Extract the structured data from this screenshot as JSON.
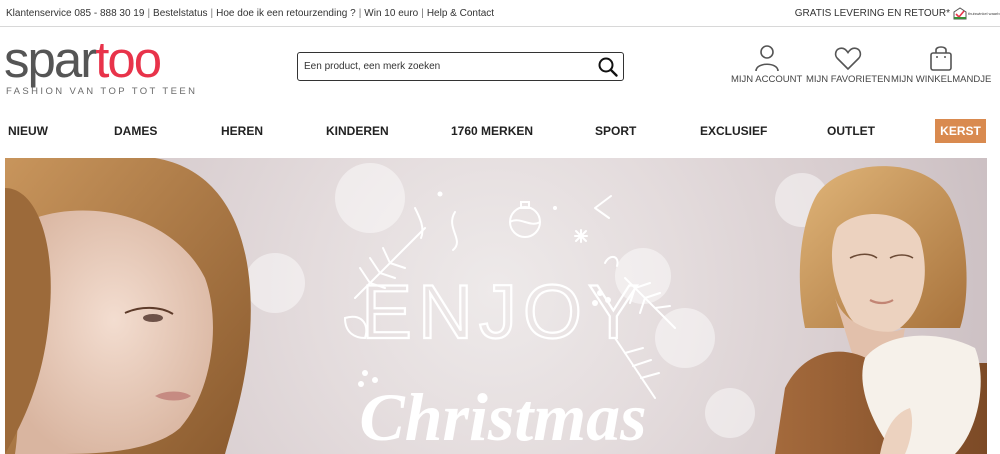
{
  "topbar": {
    "links": [
      "Klantenservice 085 - 888 30 19",
      "Bestelstatus",
      "Hoe doe ik een retourzending ?",
      "Win 10 euro",
      "Help & Contact"
    ],
    "separator": "|",
    "shipping": "GRATIS LEVERING EN RETOUR*",
    "badge_text": "thuiswinkel waarborg"
  },
  "header": {
    "logo_part1": "spar",
    "logo_part2": "too",
    "tagline": "FASHION VAN TOP TOT TEEN",
    "search_placeholder": "Een product, een merk zoeken",
    "account_label": "MIJN ACCOUNT",
    "favorites_label": "MIJN FAVORIETEN",
    "cart_label": "MIJN WINKELMANDJE"
  },
  "nav": {
    "items": [
      "NIEUW",
      "DAMES",
      "HEREN",
      "KINDEREN",
      "1760 MERKEN",
      "SPORT",
      "EXCLUSIEF",
      "OUTLET"
    ],
    "highlight": "KERST"
  },
  "hero": {
    "line1": "ENJOY",
    "line2": "Christmas"
  },
  "colors": {
    "brand_red": "#e8334a",
    "logo_gray": "#555555",
    "kerst_bg": "#d98a4f"
  }
}
